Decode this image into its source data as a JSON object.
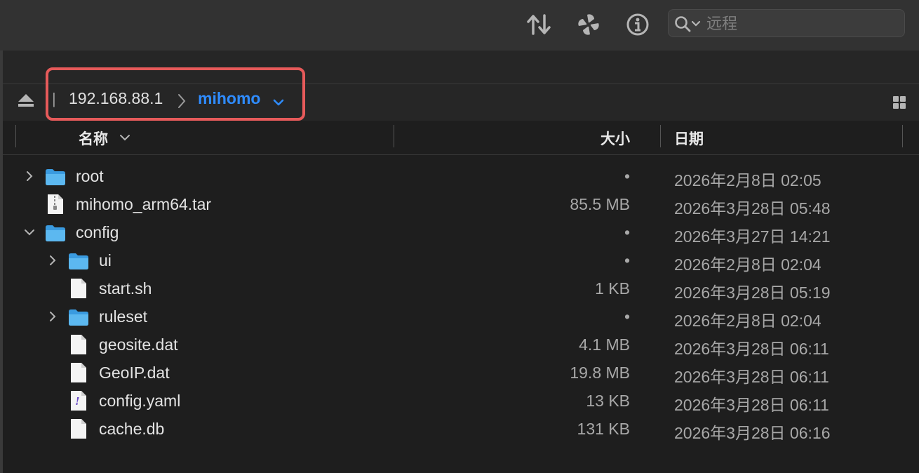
{
  "toolbar": {
    "sort_icon": "sort-arrows-icon",
    "action_icon": "pinwheel-icon",
    "info_icon": "info-icon",
    "search": {
      "placeholder": "远程",
      "value": ""
    }
  },
  "pathbar": {
    "host": "192.168.88.1",
    "current_folder": "mihomo",
    "highlight_color": "#e65a5a",
    "accent_color": "#2f8cff"
  },
  "columns": {
    "name": "名称",
    "size": "大小",
    "date": "日期"
  },
  "rows": [
    {
      "name": "root",
      "type": "folder",
      "size": "•",
      "date": "2026年2月8日 02:05",
      "disclosure": "collapsed"
    },
    {
      "name": "mihomo_arm64.tar",
      "type": "archive",
      "size": "85.5 MB",
      "date": "2026年3月28日 05:48",
      "disclosure": "none"
    },
    {
      "name": "config",
      "type": "folder",
      "size": "•",
      "date": "2026年3月27日 14:21",
      "disclosure": "expanded"
    },
    {
      "name": "ui",
      "type": "folder",
      "size": "•",
      "date": "2026年2月8日 02:04",
      "disclosure": "collapsed"
    },
    {
      "name": "start.sh",
      "type": "file",
      "size": "1 KB",
      "date": "2026年3月28日 05:19",
      "disclosure": "none"
    },
    {
      "name": "ruleset",
      "type": "folder",
      "size": "•",
      "date": "2026年2月8日 02:04",
      "disclosure": "collapsed"
    },
    {
      "name": "geosite.dat",
      "type": "file",
      "size": "4.1 MB",
      "date": "2026年3月28日 06:11",
      "disclosure": "none"
    },
    {
      "name": "GeoIP.dat",
      "type": "file",
      "size": "19.8 MB",
      "date": "2026年3月28日 06:11",
      "disclosure": "none"
    },
    {
      "name": "config.yaml",
      "type": "yaml",
      "size": "13 KB",
      "date": "2026年3月28日 06:11",
      "disclosure": "none"
    },
    {
      "name": "cache.db",
      "type": "file",
      "size": "131 KB",
      "date": "2026年3月28日 06:16",
      "disclosure": "none"
    }
  ]
}
